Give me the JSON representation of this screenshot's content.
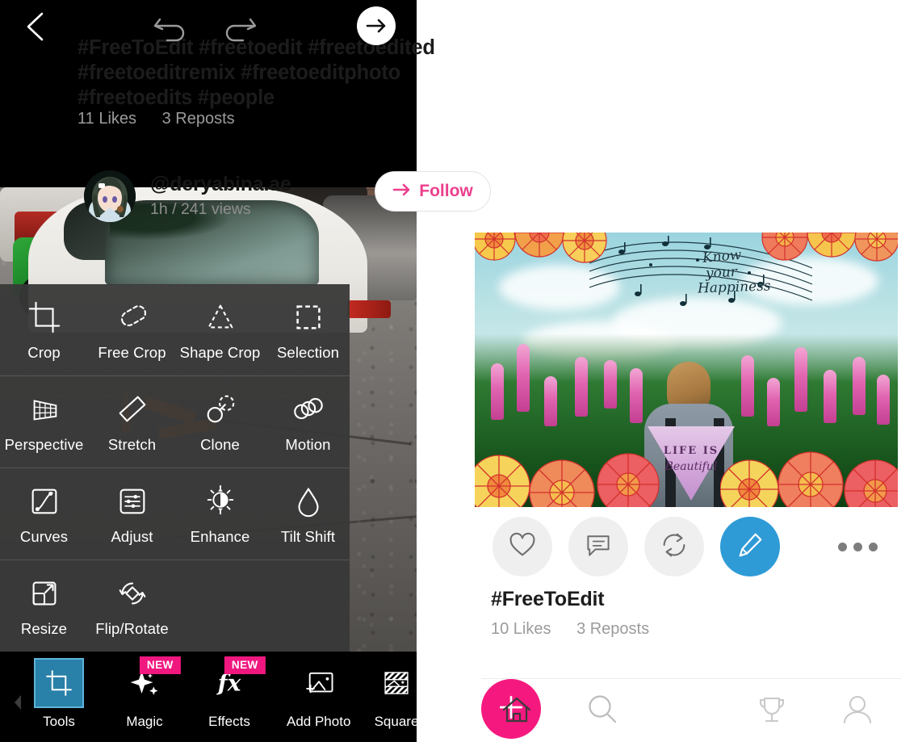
{
  "editor": {
    "topbar": {
      "back_label": "Back",
      "undo_label": "Undo",
      "redo_label": "Redo",
      "next_label": "Next"
    },
    "tool_rows": [
      [
        {
          "label": "Crop",
          "icon": "crop-icon"
        },
        {
          "label": "Free Crop",
          "icon": "free-crop-icon"
        },
        {
          "label": "Shape Crop",
          "icon": "shape-crop-icon"
        },
        {
          "label": "Selection",
          "icon": "selection-icon"
        }
      ],
      [
        {
          "label": "Perspective",
          "icon": "perspective-icon"
        },
        {
          "label": "Stretch",
          "icon": "stretch-icon"
        },
        {
          "label": "Clone",
          "icon": "clone-icon"
        },
        {
          "label": "Motion",
          "icon": "motion-icon"
        }
      ],
      [
        {
          "label": "Curves",
          "icon": "curves-icon"
        },
        {
          "label": "Adjust",
          "icon": "adjust-icon"
        },
        {
          "label": "Enhance",
          "icon": "enhance-icon"
        },
        {
          "label": "Tilt Shift",
          "icon": "tilt-shift-icon"
        }
      ],
      [
        {
          "label": "Resize",
          "icon": "resize-icon"
        },
        {
          "label": "Flip/Rotate",
          "icon": "flip-rotate-icon"
        },
        {
          "label": "",
          "icon": ""
        },
        {
          "label": "",
          "icon": ""
        }
      ]
    ],
    "bottom_nav": [
      {
        "label": "Tools",
        "icon": "crop-icon",
        "badge": "",
        "selected": true
      },
      {
        "label": "Magic",
        "icon": "sparkle-icon",
        "badge": "NEW",
        "selected": false
      },
      {
        "label": "Effects",
        "icon": "fx-icon",
        "badge": "NEW",
        "selected": false
      },
      {
        "label": "Add Photo",
        "icon": "add-photo-icon",
        "badge": "",
        "selected": false
      },
      {
        "label": "Square",
        "icon": "square-fit-icon",
        "badge": "",
        "selected": false
      }
    ],
    "colors": {
      "panel_bg": "#383838",
      "selected_tile": "#2980a8",
      "badge_pink": "#f0177f"
    }
  },
  "feed": {
    "hashtags": "#FreeToEdit  #freetoedit  #freetoedited #freetoeditremix  #freetoeditphoto #freetoedits  #people",
    "top_stats": {
      "likes": "11 Likes",
      "reposts": "3 Reposts"
    },
    "post": {
      "username": "@deryabina.ae",
      "meta": "1h / 241 views",
      "follow_label": "Follow",
      "image": {
        "song_line_1": "Know",
        "song_line_2": "your",
        "song_line_3": "Happiness",
        "patch_line_1": "LIFE IS",
        "patch_line_2": "Beautiful"
      }
    },
    "actions": [
      {
        "name": "like",
        "icon": "heart-icon"
      },
      {
        "name": "comment",
        "icon": "comment-icon"
      },
      {
        "name": "repost",
        "icon": "repost-icon"
      },
      {
        "name": "edit",
        "icon": "pencil-icon"
      },
      {
        "name": "more",
        "icon": "more-dots-icon"
      }
    ],
    "caption": "#FreeToEdit",
    "bottom_stats": {
      "likes": "10 Likes",
      "reposts": "3 Reposts"
    },
    "bottom_nav": [
      {
        "name": "home",
        "icon": "home-icon"
      },
      {
        "name": "search",
        "icon": "search-icon"
      },
      {
        "name": "create",
        "icon": "plus-icon"
      },
      {
        "name": "challenges",
        "icon": "trophy-icon"
      },
      {
        "name": "profile",
        "icon": "person-icon"
      }
    ],
    "colors": {
      "follow_pink": "#ec3f8d",
      "edit_blue": "#2e9bd6",
      "create_pink": "#f5197f",
      "muted_text": "#9b9b9b"
    }
  }
}
